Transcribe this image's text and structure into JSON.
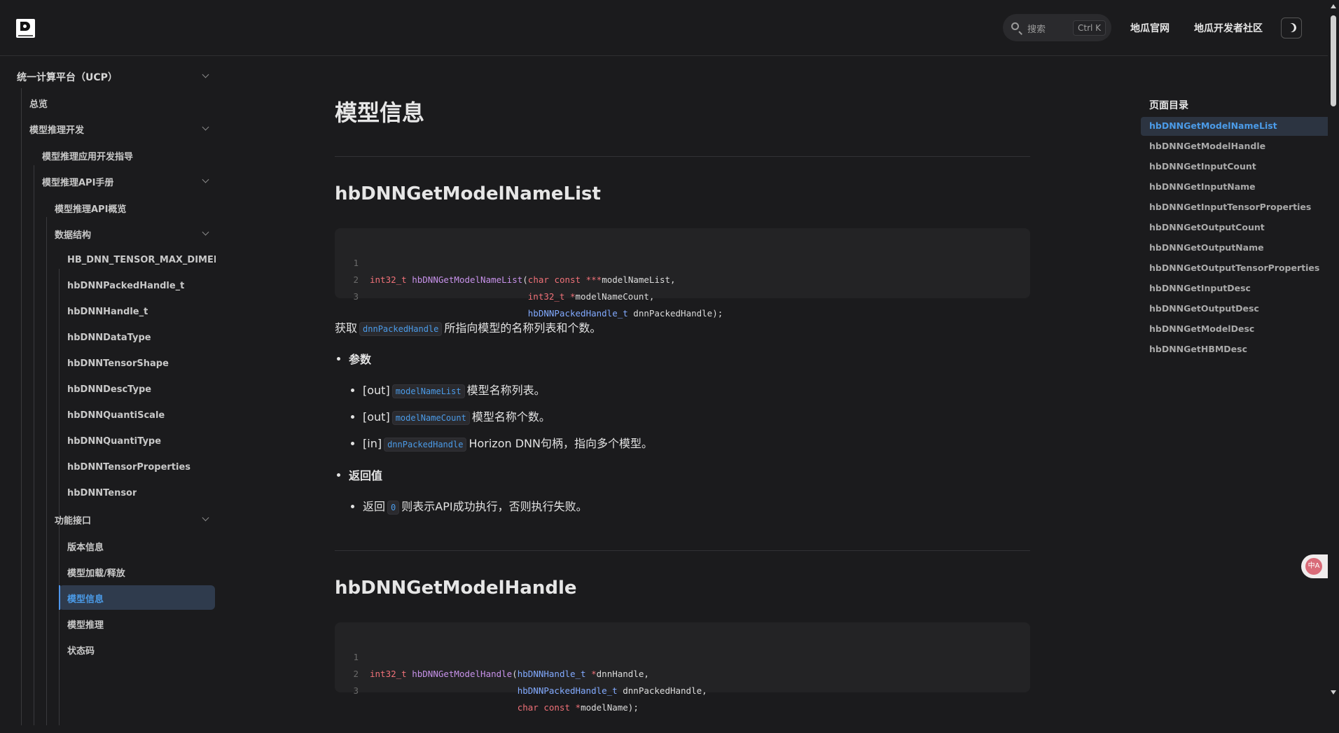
{
  "navbar": {
    "search_placeholder": "搜索",
    "search_shortcut": "Ctrl K",
    "links": [
      "地瓜官网",
      "地瓜开发者社区"
    ]
  },
  "sidebar": {
    "items": [
      {
        "label": "统一计算平台（UCP）",
        "expanded": true
      },
      {
        "label": "总览"
      },
      {
        "label": "模型推理开发",
        "expanded": true
      },
      {
        "label": "模型推理应用开发指导"
      },
      {
        "label": "模型推理API手册",
        "expanded": true
      },
      {
        "label": "模型推理API概览"
      },
      {
        "label": "数据结构",
        "expanded": true
      },
      {
        "label": "HB_DNN_TENSOR_MAX_DIMENSIONS"
      },
      {
        "label": "hbDNNPackedHandle_t"
      },
      {
        "label": "hbDNNHandle_t"
      },
      {
        "label": "hbDNNDataType"
      },
      {
        "label": "hbDNNTensorShape"
      },
      {
        "label": "hbDNNDescType"
      },
      {
        "label": "hbDNNQuantiScale"
      },
      {
        "label": "hbDNNQuantiType"
      },
      {
        "label": "hbDNNTensorProperties"
      },
      {
        "label": "hbDNNTensor"
      },
      {
        "label": "功能接口",
        "expanded": true
      },
      {
        "label": "版本信息"
      },
      {
        "label": "模型加载/释放"
      },
      {
        "label": "模型信息",
        "active": true
      },
      {
        "label": "模型推理"
      },
      {
        "label": "状态码"
      }
    ]
  },
  "main": {
    "title": "模型信息",
    "sections": [
      {
        "heading": "hbDNNGetModelNameList",
        "code": {
          "line_numbers": [
            "1",
            "2",
            "3"
          ]
        },
        "desc_prefix": "获取",
        "desc_code": "dnnPackedHandle",
        "desc_suffix": "所指向模型的名称列表和个数。",
        "params_label": "参数",
        "params": [
          {
            "dir": "[out]",
            "name": "modelNameList",
            "desc": "模型名称列表。"
          },
          {
            "dir": "[out]",
            "name": "modelNameCount",
            "desc": "模型名称个数。"
          },
          {
            "dir": "[in]",
            "name": "dnnPackedHandle",
            "desc": "Horizon DNN句柄，指向多个模型。"
          }
        ],
        "return_label": "返回值",
        "return_prefix": "返回",
        "return_code": "0",
        "return_suffix": "则表示API成功执行，否则执行失败。"
      },
      {
        "heading": "hbDNNGetModelHandle",
        "code": {
          "line_numbers": [
            "1",
            "2",
            "3"
          ]
        }
      }
    ]
  },
  "toc": {
    "title": "页面目录",
    "items": [
      "hbDNNGetModelNameList",
      "hbDNNGetModelHandle",
      "hbDNNGetInputCount",
      "hbDNNGetInputName",
      "hbDNNGetInputTensorProperties",
      "hbDNNGetOutputCount",
      "hbDNNGetOutputName",
      "hbDNNGetOutputTensorProperties",
      "hbDNNGetInputDesc",
      "hbDNNGetOutputDesc",
      "hbDNNGetModelDesc",
      "hbDNNGetHBMDesc"
    ],
    "active_index": 0
  },
  "float_button": {
    "label": "中A"
  },
  "colors": {
    "background": "#1b1b1d",
    "accent": "#4b9be8",
    "code_type": "#f07178",
    "code_function": "#c792ea",
    "code_typedef": "#82aaff"
  }
}
